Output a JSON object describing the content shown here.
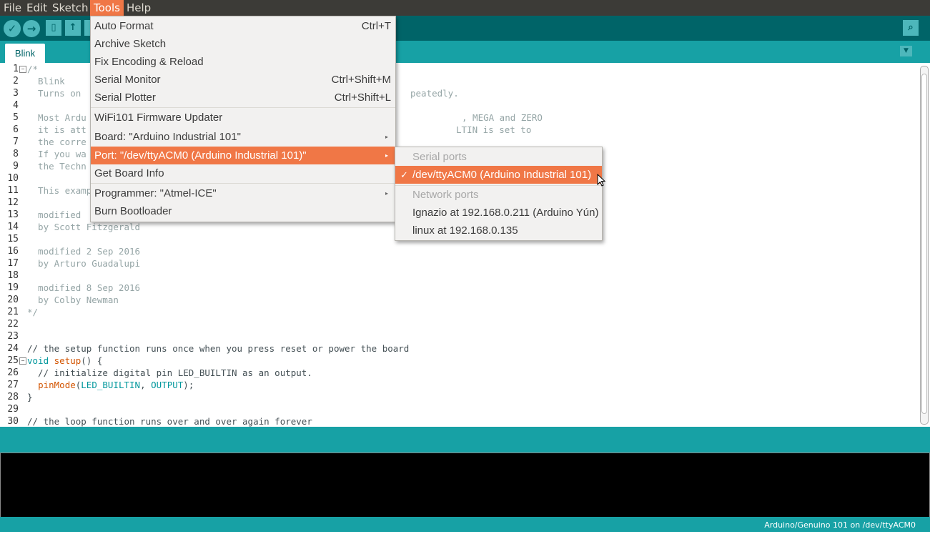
{
  "menubar": {
    "file": "File",
    "edit": "Edit",
    "sketch": "Sketch",
    "tools": "Tools",
    "help": "Help"
  },
  "toolbar": {
    "verify_icon": "✓",
    "upload_icon": "→",
    "new_icon": "▯",
    "open_icon": "↑",
    "save_icon": "↓",
    "serial_monitor_icon": "⌕"
  },
  "tabs": {
    "active": "Blink",
    "menu_icon": "▼"
  },
  "editor": {
    "lines": [
      {
        "n": "1",
        "t": "/*"
      },
      {
        "n": "2",
        "t": "  Blink"
      },
      {
        "n": "3",
        "t": "  Turns on",
        "t2": "peatedly."
      },
      {
        "n": "4",
        "t": ""
      },
      {
        "n": "5",
        "t": "  Most Ardu",
        "t2": ", MEGA and ZERO"
      },
      {
        "n": "6",
        "t": "  it is att",
        "t2": "LTIN is set to"
      },
      {
        "n": "7",
        "t": "  the corre"
      },
      {
        "n": "8",
        "t": "  If you wa"
      },
      {
        "n": "9",
        "t": "  the Techn"
      },
      {
        "n": "10",
        "t": ""
      },
      {
        "n": "11",
        "t": "  This examp"
      },
      {
        "n": "12",
        "t": ""
      },
      {
        "n": "13",
        "t": "  modified "
      },
      {
        "n": "14",
        "t": "  by Scott Fitzgerald"
      },
      {
        "n": "15",
        "t": ""
      },
      {
        "n": "16",
        "t": "  modified 2 Sep 2016"
      },
      {
        "n": "17",
        "t": "  by Arturo Guadalupi"
      },
      {
        "n": "18",
        "t": ""
      },
      {
        "n": "19",
        "t": "  modified 8 Sep 2016"
      },
      {
        "n": "20",
        "t": "  by Colby Newman"
      },
      {
        "n": "21",
        "t": "*/"
      },
      {
        "n": "22",
        "t": ""
      },
      {
        "n": "23",
        "t": ""
      },
      {
        "n": "24",
        "t": "// the setup function runs once when you press reset or power the board"
      },
      {
        "n": "25",
        "t": "void setup() {"
      },
      {
        "n": "26",
        "t": "  // initialize digital pin LED_BUILTIN as an output."
      },
      {
        "n": "27",
        "t": "  pinMode(LED_BUILTIN, OUTPUT);"
      },
      {
        "n": "28",
        "t": "}"
      },
      {
        "n": "29",
        "t": ""
      },
      {
        "n": "30",
        "t": "// the loop function runs over and over again forever"
      }
    ]
  },
  "tools_menu": {
    "items": [
      {
        "label": "Auto Format",
        "shortcut": "Ctrl+T"
      },
      {
        "label": "Archive Sketch",
        "shortcut": ""
      },
      {
        "label": "Fix Encoding & Reload",
        "shortcut": ""
      },
      {
        "label": "Serial Monitor",
        "shortcut": "Ctrl+Shift+M"
      },
      {
        "label": "Serial Plotter",
        "shortcut": "Ctrl+Shift+L"
      },
      {
        "label": "WiFi101 Firmware Updater",
        "shortcut": ""
      },
      {
        "label": "Board: \"Arduino Industrial 101\"",
        "shortcut": ""
      },
      {
        "label": "Port: \"/dev/ttyACM0 (Arduino Industrial 101)\"",
        "shortcut": ""
      },
      {
        "label": "Get Board Info",
        "shortcut": ""
      },
      {
        "label": "Programmer: \"Atmel-ICE\"",
        "shortcut": ""
      },
      {
        "label": "Burn Bootloader",
        "shortcut": ""
      }
    ],
    "submenu_arrow": "▸"
  },
  "port_submenu": {
    "serial_header": "Serial ports",
    "selected_port": "/dev/ttyACM0 (Arduino Industrial 101)",
    "check": "✓",
    "network_header": "Network ports",
    "network_items": [
      "Ignazio at 192.168.0.211 (Arduino Yún)",
      "linux at 192.168.0.135"
    ]
  },
  "status": {
    "board_port": "Arduino/Genuino 101 on /dev/ttyACM0"
  },
  "colors": {
    "accent": "#f07746",
    "toolbar": "#006468",
    "tabbar": "#17a1a5",
    "menubar": "#3c3b37"
  }
}
